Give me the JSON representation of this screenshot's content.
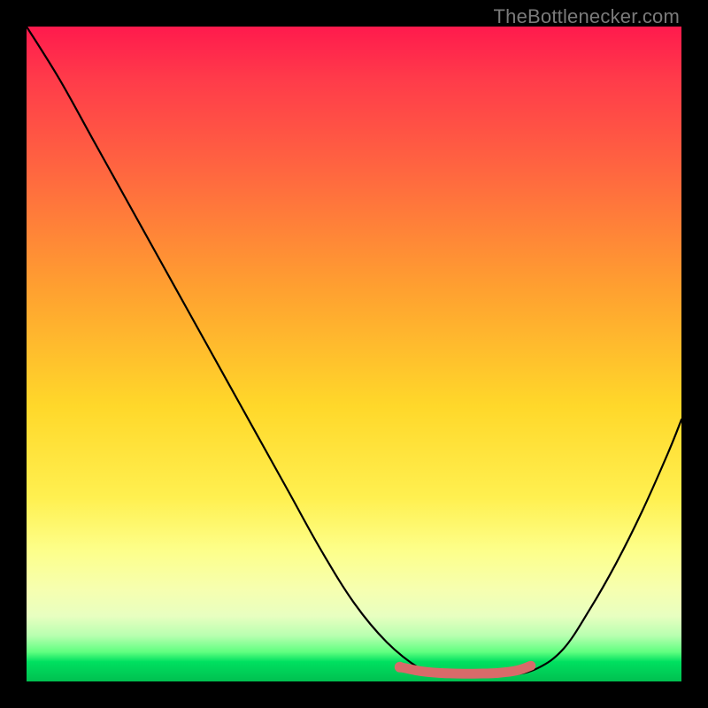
{
  "watermark": {
    "text": "TheBottlenecker.com"
  },
  "chart_data": {
    "type": "line",
    "title": "",
    "xlabel": "",
    "ylabel": "",
    "xlim": [
      0,
      100
    ],
    "ylim": [
      0,
      100
    ],
    "series": [
      {
        "name": "bottleneck-curve",
        "x": [
          0,
          5,
          10,
          15,
          20,
          25,
          30,
          35,
          40,
          45,
          50,
          55,
          60,
          63,
          66,
          70,
          74,
          78,
          82,
          86,
          90,
          94,
          98,
          100
        ],
        "y": [
          100,
          92,
          83,
          74,
          65,
          56,
          47,
          38,
          29,
          20,
          12,
          6,
          2,
          1,
          1,
          1,
          1,
          2,
          5,
          11,
          18,
          26,
          35,
          40
        ]
      },
      {
        "name": "optimal-band",
        "x": [
          57,
          60,
          63,
          66,
          69,
          72,
          75,
          77
        ],
        "y": [
          2.2,
          1.6,
          1.3,
          1.2,
          1.2,
          1.3,
          1.7,
          2.4
        ]
      }
    ],
    "colors": {
      "curve": "#000000",
      "optimal_band": "#d86a6a",
      "gradient_top": "#ff1a4d",
      "gradient_mid": "#ffd82a",
      "gradient_bottom": "#00c050"
    }
  }
}
